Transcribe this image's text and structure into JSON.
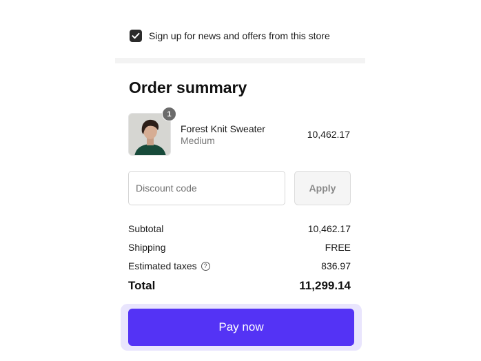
{
  "newsletter": {
    "checked": true,
    "label": "Sign up for news and offers from this store"
  },
  "summary": {
    "title": "Order summary",
    "items": [
      {
        "quantity": "1",
        "name": "Forest Knit Sweater",
        "variant": "Medium",
        "price": "10,462.17"
      }
    ]
  },
  "discount": {
    "placeholder": "Discount code",
    "apply_label": "Apply"
  },
  "totals": {
    "subtotal_label": "Subtotal",
    "subtotal_value": "10,462.17",
    "shipping_label": "Shipping",
    "shipping_value": "FREE",
    "taxes_label": "Estimated taxes",
    "taxes_info_icon": "?",
    "taxes_value": "836.97",
    "total_label": "Total",
    "total_value": "11,299.14"
  },
  "pay": {
    "label": "Pay now"
  },
  "colors": {
    "accent": "#5433f5",
    "accent_halo": "#e9e5fd",
    "badge": "#6b6b6b"
  }
}
